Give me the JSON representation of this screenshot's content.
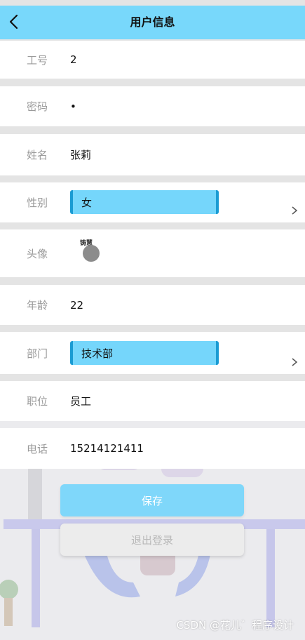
{
  "header": {
    "title": "用户信息",
    "back_icon": "chevron-left-icon"
  },
  "fields": {
    "employee_id": {
      "label": "工号",
      "value": "2"
    },
    "password": {
      "label": "密码",
      "value": "•"
    },
    "name": {
      "label": "姓名",
      "value": "张莉"
    },
    "gender": {
      "label": "性别",
      "value": "女"
    },
    "avatar": {
      "label": "头像",
      "image_text": "铸慧"
    },
    "age": {
      "label": "年龄",
      "value": "22"
    },
    "department": {
      "label": "部门",
      "value": "技术部"
    },
    "position": {
      "label": "职位",
      "value": "员工"
    },
    "phone": {
      "label": "电话",
      "value": "15214121411"
    }
  },
  "actions": {
    "save_label": "保存",
    "logout_label": "退出登录"
  },
  "watermark": "CSDN @花儿゛程序设计",
  "colors": {
    "accent": "#78d8fb",
    "picker_border": "#1a9bd3",
    "label": "#9a9a9a"
  }
}
